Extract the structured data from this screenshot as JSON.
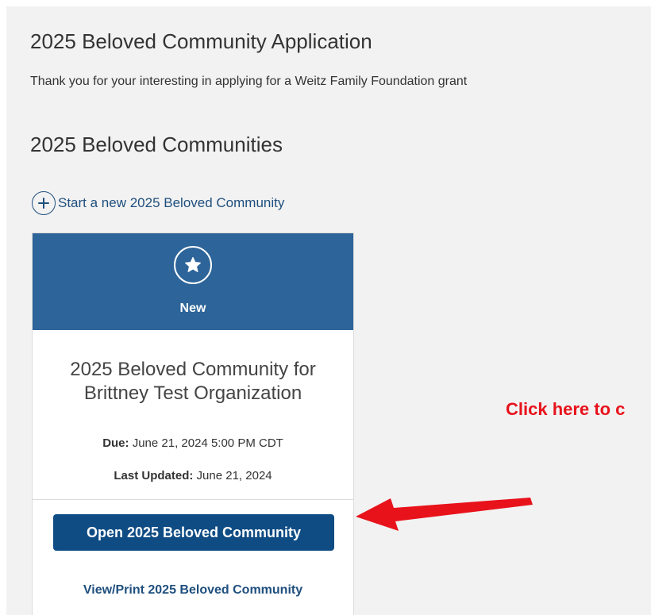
{
  "page": {
    "title": "2025 Beloved Community Application",
    "intro": "Thank you for your interesting in applying for a Weitz Family Foundation grant"
  },
  "section": {
    "title": "2025 Beloved Communities",
    "start_link": "Start a new 2025 Beloved Community",
    "start_icon": "plus-circle-icon"
  },
  "card": {
    "status": "New",
    "status_icon": "star-icon",
    "header_color": "#2d6499",
    "title": "2025 Beloved Community for Brittney Test Organization",
    "due_label": "Due:",
    "due_value": "June 21, 2024 5:00 PM CDT",
    "updated_label": "Last Updated:",
    "updated_value": "June 21, 2024",
    "open_button": "Open 2025 Beloved Community",
    "view_link": "View/Print 2025 Beloved Community"
  },
  "annotation": {
    "text": "Click here to c",
    "color": "#e8121b",
    "arrow_icon": "red-arrow-icon"
  }
}
